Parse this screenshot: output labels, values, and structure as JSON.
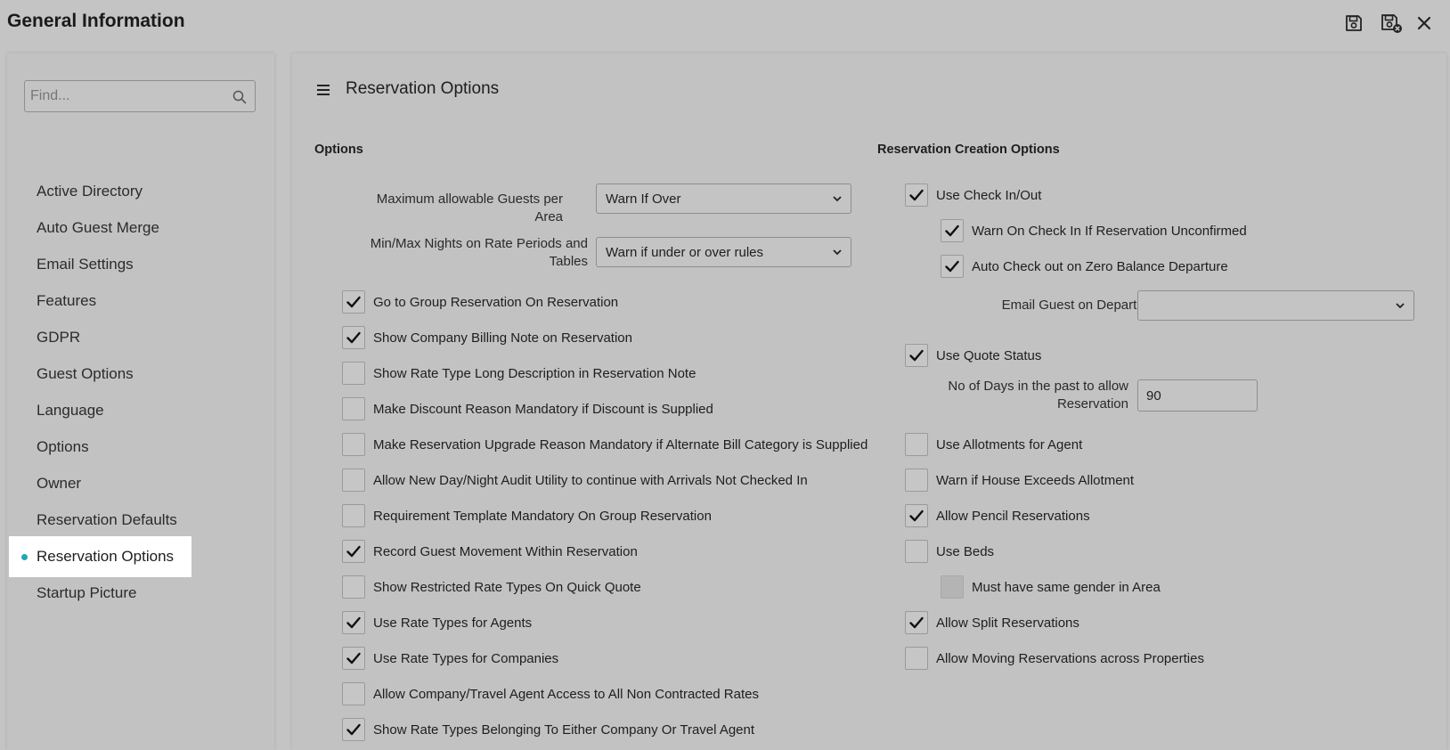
{
  "window": {
    "title": "General Information"
  },
  "toolbar": {
    "save_icon": "save-icon",
    "save_close_icon": "save-close-icon",
    "close_icon": "close-icon"
  },
  "sidebar": {
    "search_placeholder": "Find...",
    "items": [
      {
        "label": "Active Directory"
      },
      {
        "label": "Auto Guest Merge"
      },
      {
        "label": "Email Settings"
      },
      {
        "label": "Features"
      },
      {
        "label": "GDPR"
      },
      {
        "label": "Guest Options"
      },
      {
        "label": "Language"
      },
      {
        "label": "Options"
      },
      {
        "label": "Owner"
      },
      {
        "label": "Reservation Defaults"
      },
      {
        "label": "Reservation Options",
        "active": true
      },
      {
        "label": "Startup Picture"
      }
    ],
    "active_color": "#1ea7b8"
  },
  "main": {
    "title": "Reservation Options",
    "options": {
      "heading": "Options",
      "max_guests_label": "Maximum allowable Guests per Area",
      "max_guests_value": "Warn If Over",
      "min_max_nights_label_line1": "Min/Max Nights on Rate Periods and",
      "min_max_nights_label_line2": "Tables",
      "min_max_nights_value": "Warn if under or over rules",
      "checkboxes": [
        {
          "label": "Go to Group Reservation On Reservation",
          "checked": true
        },
        {
          "label": "Show Company Billing Note on Reservation",
          "checked": true
        },
        {
          "label": "Show Rate Type Long Description in Reservation Note",
          "checked": false
        },
        {
          "label": "Make Discount Reason Mandatory if Discount is Supplied",
          "checked": false
        },
        {
          "label": "Make Reservation Upgrade Reason Mandatory if Alternate Bill Category is Supplied",
          "checked": false
        },
        {
          "label": "Allow New Day/Night Audit Utility to continue with Arrivals Not Checked In",
          "checked": false
        },
        {
          "label": "Requirement Template Mandatory On Group Reservation",
          "checked": false
        },
        {
          "label": "Record Guest Movement Within Reservation",
          "checked": true
        },
        {
          "label": "Show Restricted Rate Types On Quick Quote",
          "checked": false
        },
        {
          "label": "Use Rate Types for Agents",
          "checked": true
        },
        {
          "label": "Use Rate Types for Companies",
          "checked": true
        },
        {
          "label": "Allow Company/Travel Agent Access to All Non Contracted Rates",
          "checked": false
        },
        {
          "label": "Show Rate Types Belonging To Either Company Or Travel Agent",
          "checked": true
        }
      ]
    },
    "creation": {
      "heading": "Reservation Creation Options",
      "use_check_in_out": {
        "label": "Use Check In/Out",
        "checked": true
      },
      "warn_unconfirmed": {
        "label": "Warn On Check In If Reservation Unconfirmed",
        "checked": true
      },
      "auto_check_out": {
        "label": "Auto Check out on Zero Balance Departure",
        "checked": true
      },
      "email_guest_label": "Email Guest on Departure",
      "email_guest_value": "",
      "use_quote_status": {
        "label": "Use Quote Status",
        "checked": true
      },
      "days_past_label_line1": "No of Days in the past to allow",
      "days_past_label_line2": "Reservation",
      "days_past_value": "90",
      "use_allotments": {
        "label": "Use Allotments for Agent",
        "checked": false
      },
      "warn_house_exceeds": {
        "label": "Warn if House Exceeds Allotment",
        "checked": false
      },
      "allow_pencil": {
        "label": "Allow Pencil Reservations",
        "checked": true
      },
      "use_beds": {
        "label": "Use Beds",
        "checked": false
      },
      "same_gender": {
        "label": "Must have same gender in Area",
        "checked": false,
        "disabled": true
      },
      "allow_split": {
        "label": "Allow Split Reservations",
        "checked": true
      },
      "allow_moving": {
        "label": "Allow Moving Reservations across Properties",
        "checked": false
      }
    }
  }
}
